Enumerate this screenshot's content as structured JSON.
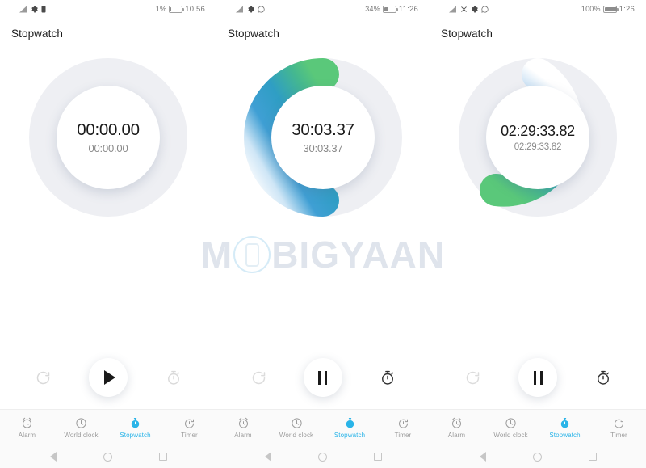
{
  "watermark": {
    "text_before": "M",
    "text_after": "BIGYAAN",
    "icon": "phone-in-circle-icon"
  },
  "panels": [
    {
      "status": {
        "icons": [
          "signal-icon",
          "settings-gear-icon",
          "sim-card-icon"
        ],
        "battery_percent": "1%",
        "battery_level": 4,
        "time": "10:56"
      },
      "title": "Stopwatch",
      "dial": {
        "time_main": "00:00.00",
        "time_lap": "00:00.00",
        "progress": 0,
        "arc_start_color": "#e8eaee",
        "arc_end_color": "#e8eaee"
      },
      "controls": {
        "reset": {
          "name": "reset-button",
          "icon": "reset-circular-arrow-icon",
          "color": "#d8d8d8"
        },
        "main": {
          "name": "start-button",
          "icon": "play-icon"
        },
        "lap": {
          "name": "lap-button",
          "icon": "stopwatch-lap-icon",
          "color": "#d8d8d8"
        }
      },
      "tabs": [
        {
          "label": "Alarm",
          "icon": "alarm-clock-icon",
          "active": false
        },
        {
          "label": "World clock",
          "icon": "world-clock-icon",
          "active": false
        },
        {
          "label": "Stopwatch",
          "icon": "stopwatch-icon",
          "active": true
        },
        {
          "label": "Timer",
          "icon": "timer-icon",
          "active": false
        }
      ]
    },
    {
      "status": {
        "icons": [
          "signal-icon",
          "settings-gear-icon",
          "whatsapp-icon"
        ],
        "battery_percent": "34%",
        "battery_level": 34,
        "time": "11:26"
      },
      "title": "Stopwatch",
      "dial": {
        "time_main": "30:03.37",
        "time_lap": "30:03.37",
        "progress": 0.5,
        "arc_start_color": "#3aa9d8",
        "arc_end_color": "#4cc47f"
      },
      "controls": {
        "reset": {
          "name": "reset-button",
          "icon": "reset-circular-arrow-icon",
          "color": "#dcdcdc"
        },
        "main": {
          "name": "pause-button",
          "icon": "pause-icon"
        },
        "lap": {
          "name": "lap-button",
          "icon": "stopwatch-lap-icon",
          "color": "#333333"
        }
      },
      "tabs": [
        {
          "label": "Alarm",
          "icon": "alarm-clock-icon",
          "active": false
        },
        {
          "label": "World clock",
          "icon": "world-clock-icon",
          "active": false
        },
        {
          "label": "Stopwatch",
          "icon": "stopwatch-icon",
          "active": true
        },
        {
          "label": "Timer",
          "icon": "timer-icon",
          "active": false
        }
      ]
    },
    {
      "status": {
        "icons": [
          "signal-icon",
          "mute-icon",
          "settings-gear-icon",
          "whatsapp-icon"
        ],
        "battery_percent": "100%",
        "battery_level": 100,
        "time": "1:26"
      },
      "title": "Stopwatch",
      "dial": {
        "time_main": "02:29:33.82",
        "time_lap": "02:29:33.82",
        "progress": 0.56,
        "arc_start_color": "#4fb7e8",
        "arc_end_color": "#4cc47f"
      },
      "controls": {
        "reset": {
          "name": "reset-button",
          "icon": "reset-circular-arrow-icon",
          "color": "#dcdcdc"
        },
        "main": {
          "name": "pause-button",
          "icon": "pause-icon"
        },
        "lap": {
          "name": "lap-button",
          "icon": "stopwatch-lap-icon",
          "color": "#333333"
        }
      },
      "tabs": [
        {
          "label": "Alarm",
          "icon": "alarm-clock-icon",
          "active": false
        },
        {
          "label": "World clock",
          "icon": "world-clock-icon",
          "active": false
        },
        {
          "label": "Stopwatch",
          "icon": "stopwatch-icon",
          "active": true
        },
        {
          "label": "Timer",
          "icon": "timer-icon",
          "active": false
        }
      ]
    }
  ],
  "android_nav": {
    "back": "back-triangle-icon",
    "home": "home-circle-icon",
    "recents": "recents-square-icon"
  },
  "colors": {
    "accent": "#2ab4e8",
    "ring_track": "#eceef2",
    "text_primary": "#1a1a1a",
    "text_secondary": "#8a8a8a"
  }
}
